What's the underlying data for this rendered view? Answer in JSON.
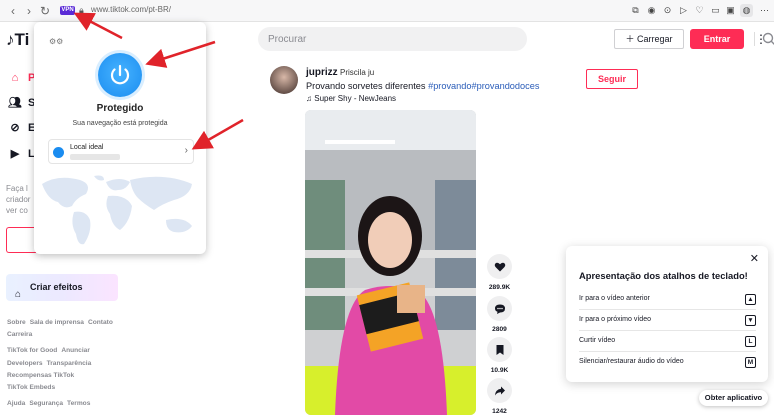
{
  "browser": {
    "vpn_badge": "VPN",
    "url": "www.tiktok.com/pt-BR/"
  },
  "header": {
    "logo_text": "Ti",
    "search_placeholder": "Procurar",
    "upload_label": "Carregar",
    "login_label": "Entrar"
  },
  "sidebar": {
    "items": [
      {
        "icon": "home-icon",
        "label": "P"
      },
      {
        "icon": "users-icon",
        "label": "S"
      },
      {
        "icon": "explore-icon",
        "label": "E"
      },
      {
        "icon": "live-icon",
        "label": "Li"
      }
    ],
    "hint_lines": [
      "Faça l",
      "criador",
      "ver co"
    ],
    "effects_label": "Criar efeitos",
    "footer": [
      [
        "Sobre",
        "Sala de imprensa",
        "Contato"
      ],
      [
        "Carreira"
      ],
      [
        "TikTok for Good",
        "Anunciar"
      ],
      [
        "Developers",
        "Transparência"
      ],
      [
        "Recompensas TikTok"
      ],
      [
        "TikTok Embeds"
      ],
      [
        "Ajuda",
        "Segurança",
        "Termos"
      ]
    ]
  },
  "vpn_popup": {
    "status_title": "Protegido",
    "status_subtitle": "Sua navegação está protegida",
    "location_label": "Local ideal"
  },
  "post": {
    "username": "juprizz",
    "display_name": "Priscila ju",
    "caption_text": "Provando sorvetes diferentes",
    "hashtags": "#provando#provandodoces",
    "music": "Super Shy - NewJeans",
    "follow_label": "Seguir",
    "likes": "289.9K",
    "comments": "2809",
    "saves": "10.9K",
    "shares": "1242"
  },
  "shortcuts": {
    "title": "Apresentação dos atalhos de teclado!",
    "items": [
      {
        "label": "Ir para o vídeo anterior",
        "key": "▲"
      },
      {
        "label": "Ir para o próximo vídeo",
        "key": "▼"
      },
      {
        "label": "Curtir vídeo",
        "key": "L"
      },
      {
        "label": "Silenciar/restaurar áudio do vídeo",
        "key": "M"
      }
    ]
  },
  "open_app_label": "Obter aplicativo",
  "colors": {
    "brand": "#fe2c55",
    "vpn_blue": "#1a8cf0",
    "annotation_arrow": "#e0232a",
    "hashtag": "#2b5db9"
  }
}
